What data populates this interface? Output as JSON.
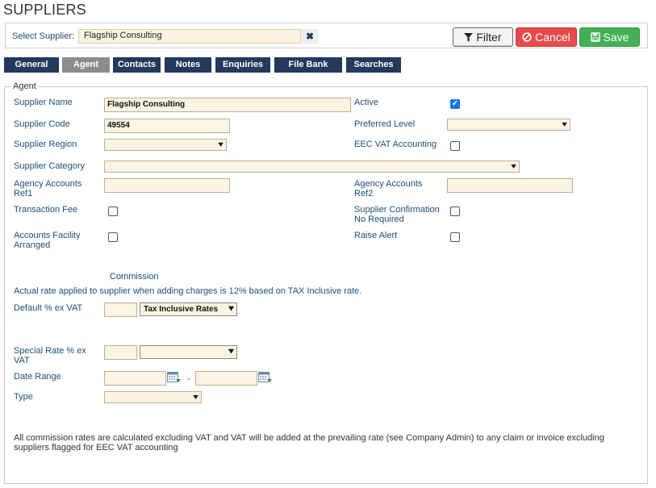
{
  "page": {
    "title": "SUPPLIERS"
  },
  "supplier_select": {
    "label": "Select Supplier:",
    "value": "Flagship Consulting",
    "clear_icon": "times-icon"
  },
  "toolbar": {
    "filter_label": "Filter",
    "cancel_label": "Cancel",
    "save_label": "Save"
  },
  "tabs": [
    {
      "label": "General"
    },
    {
      "label": "Agent",
      "active": true
    },
    {
      "label": "Contacts"
    },
    {
      "label": "Notes"
    },
    {
      "label": "Enquiries"
    },
    {
      "label": "File Bank"
    },
    {
      "label": "Searches"
    }
  ],
  "agent": {
    "legend": "Agent",
    "supplier_name_label": "Supplier Name",
    "supplier_name_value": "Flagship Consulting",
    "active_label": "Active",
    "active_checked": true,
    "supplier_code_label": "Supplier Code",
    "supplier_code_value": "49554",
    "preferred_level_label": "Preferred Level",
    "supplier_region_label": "Supplier Region",
    "eec_vat_label": "EEC VAT Accounting",
    "supplier_category_label": "Supplier Category",
    "agency_ref1_label_1": "Agency Accounts",
    "agency_ref1_label_2": "Ref1",
    "agency_ref2_label_1": "Agency Accounts",
    "agency_ref2_label_2": "Ref2",
    "transaction_fee_label": "Transaction Fee",
    "supplier_confirmation_label_1": "Supplier Confirmation",
    "supplier_confirmation_label_2": "No Required",
    "accounts_facility_label_1": "Accounts Facility",
    "accounts_facility_label_2": "Arranged",
    "raise_alert_label": "Raise Alert"
  },
  "commission": {
    "heading": "Commission",
    "note": "Actual rate applied to supplier when adding charges is 12% based on TAX Inclusive rate.",
    "default_label": "Default % ex VAT",
    "default_rate_type": "Tax Inclusive Rates",
    "special_label_1": "Special Rate % ex",
    "special_label_2": "VAT",
    "date_range_label": "Date Range",
    "date_separator": "-",
    "type_label": "Type",
    "footer_line1": "All commission rates are calculated excluding VAT and VAT will be added at the prevailing rate (see Company Admin) to any claim or invoice excluding",
    "footer_line2": "suppliers flagged for EEC VAT accounting"
  },
  "colors": {
    "tab_bg": "#23395d",
    "tab_active_bg": "#8c8c8c",
    "label_blue": "#1f4e79",
    "input_bg": "#fbf4e2",
    "cancel": "#e84b4b",
    "save": "#44b055"
  }
}
